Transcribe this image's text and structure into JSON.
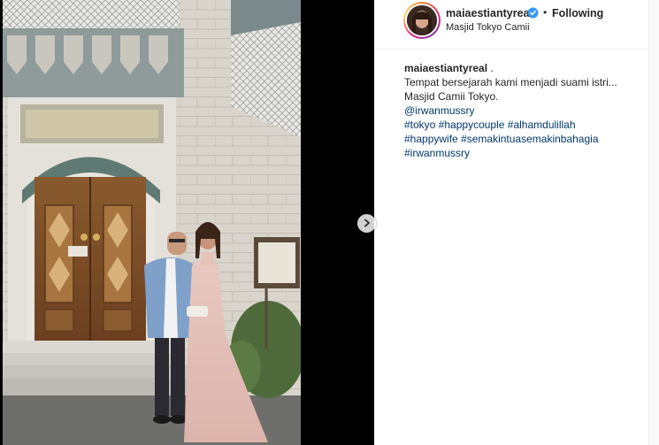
{
  "post": {
    "username": "maiaestiantyreal",
    "following_label": "Following",
    "separator": "•",
    "location": "Masjid Tokyo Camii",
    "caption": {
      "username": "maiaestiantyreal",
      "username_suffix": " .",
      "text": "Tempat bersejarah kami menjadi suami istri... Masjid Camii Tokyo.",
      "mention": "@irwanmussry",
      "hashtags_line1": [
        "#tokyo",
        "#happycouple",
        "#alhamdulillah"
      ],
      "hashtags_line2": [
        "#happywife",
        "#semakintuasemakinbahagia"
      ],
      "hashtags_line3": [
        "#irwanmussry"
      ]
    }
  },
  "colors": {
    "link": "#00376b",
    "verified": "#3897f0",
    "text": "#262626"
  },
  "icons": {
    "verified": "verified-badge-icon",
    "next": "chevron-right-icon"
  },
  "carousel": {
    "current": 2,
    "total": 2
  }
}
